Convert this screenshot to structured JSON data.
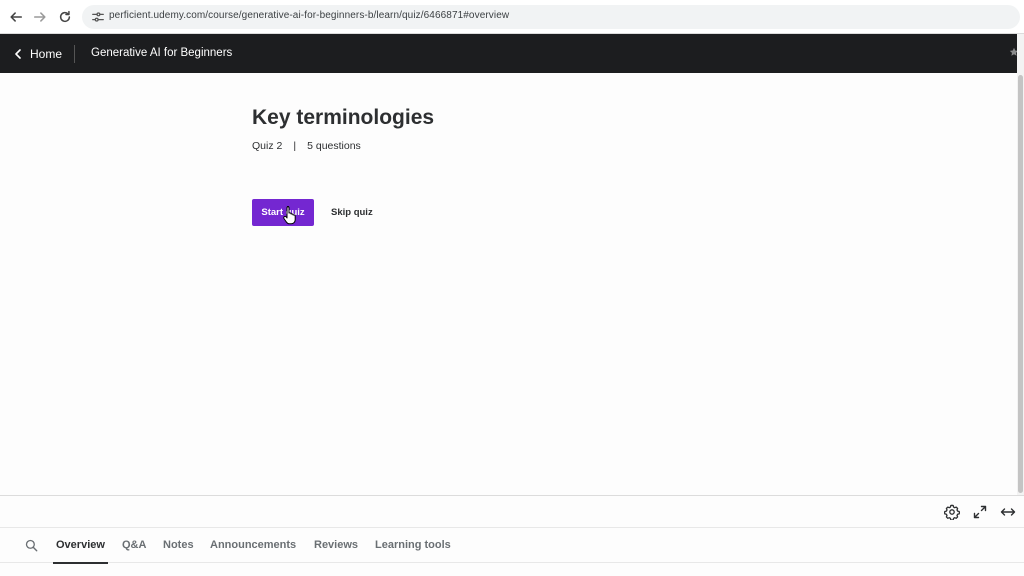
{
  "browser": {
    "url": "perficient.udemy.com/course/generative-ai-for-beginners-b/learn/quiz/6466871#overview"
  },
  "header": {
    "home_label": "Home",
    "course_title": "Generative AI for Beginners"
  },
  "quiz": {
    "title": "Key terminologies",
    "quiz_number": "Quiz 2",
    "separator": "|",
    "question_count": "5 questions",
    "start_label": "Start quiz",
    "skip_label": "Skip quiz"
  },
  "tabs": {
    "items": [
      {
        "label": "Overview",
        "active": true
      },
      {
        "label": "Q&A"
      },
      {
        "label": "Notes"
      },
      {
        "label": "Announcements"
      },
      {
        "label": "Reviews"
      },
      {
        "label": "Learning tools"
      }
    ]
  },
  "icons": {
    "back": "back-arrow-icon",
    "forward": "forward-arrow-icon",
    "reload": "reload-icon",
    "site_settings": "site-settings-icon",
    "settings": "gear-icon",
    "fullscreen": "fullscreen-icon",
    "expand": "expand-horizontal-icon",
    "search": "search-icon",
    "cursor": "hand-cursor-icon"
  },
  "colors": {
    "primary": "#7427d1",
    "header_bg": "#1c1d1f",
    "text": "#2d2f31"
  }
}
